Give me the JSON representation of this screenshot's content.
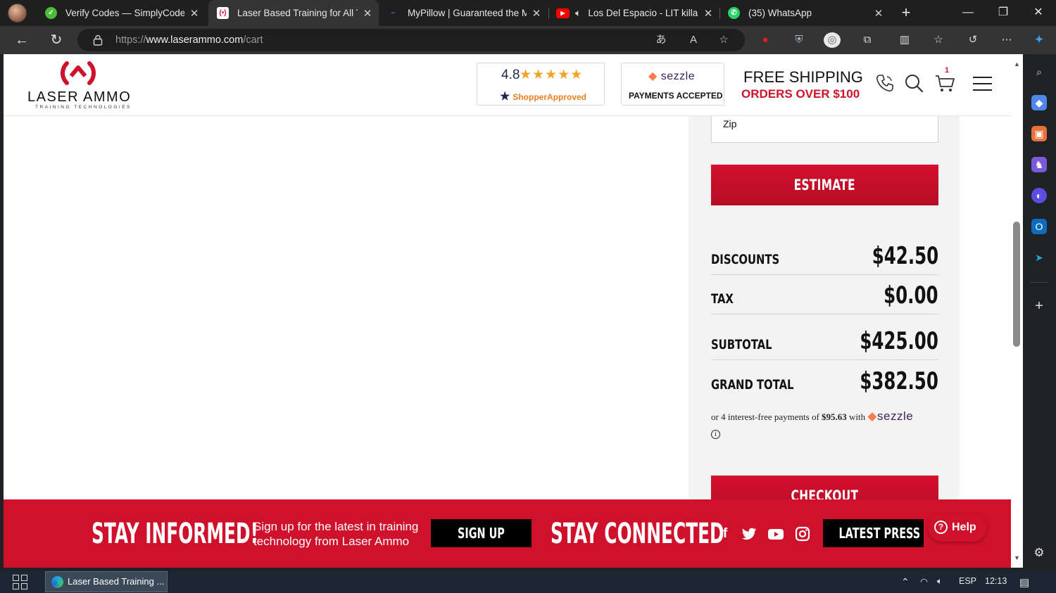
{
  "browser": {
    "tabs": [
      {
        "title": "Verify Codes — SimplyCodes",
        "favicon": "simplycodes-icon",
        "active": false
      },
      {
        "title": "Laser Based Training for All Ty",
        "favicon": "laser-ammo-icon",
        "active": true
      },
      {
        "title": "MyPillow | Guaranteed the Mo",
        "favicon": "mypillow-icon",
        "active": false
      },
      {
        "title": "Los Del Espacio - LIT killa",
        "favicon": "youtube-icon",
        "active": false
      },
      {
        "title": "(35) WhatsApp",
        "favicon": "whatsapp-icon",
        "active": false
      }
    ],
    "url_prefix": "https://",
    "url_host": "www.laserammo.com",
    "url_path": "/cart"
  },
  "site": {
    "logo_text": "LASER AMMO",
    "logo_sub": "TRAINING TECHNOLOGIES",
    "rating": "4.8",
    "stars": "★★★★★",
    "shopper_approved": "ShopperApproved",
    "sezzle_brand": "sezzle",
    "payments_accepted": "PAYMENTS ACCEPTED",
    "free_shipping": "FREE SHIPPING",
    "orders_over": "ORDERS OVER $100",
    "cart_count": "1"
  },
  "summary": {
    "zip_placeholder": "Zip",
    "estimate_label": "ESTIMATE",
    "rows": [
      {
        "label": "DISCOUNTS",
        "value": "$42.50"
      },
      {
        "label": "TAX",
        "value": "$0.00"
      },
      {
        "label": "SUBTOTAL",
        "value": "$425.00"
      },
      {
        "label": "GRAND TOTAL",
        "value": "$382.50"
      }
    ],
    "sezzle_prefix": "or 4 interest-free payments of",
    "sezzle_amount": "$95.63",
    "sezzle_with": "with",
    "sezzle_brand": "sezzle",
    "checkout_label": "CHECKOUT"
  },
  "footer": {
    "stay_informed": "STAY INFORMED!",
    "signup_text_1": "Sign up for the latest in training",
    "signup_text_2": "technology from Laser Ammo",
    "signup_button": "SIGN UP",
    "stay_connected": "STAY CONNECTED",
    "social": [
      "facebook-icon",
      "twitter-icon",
      "youtube-icon",
      "instagram-icon"
    ],
    "latest_press": "LATEST PRESS",
    "help_label": "Help"
  },
  "taskbar": {
    "task_label": "Laser Based Training ...",
    "language": "ESP",
    "time": "12:13"
  },
  "colors": {
    "brand_red": "#cf112c",
    "sezzle_purple": "#392558",
    "star_orange": "#f3a325"
  }
}
